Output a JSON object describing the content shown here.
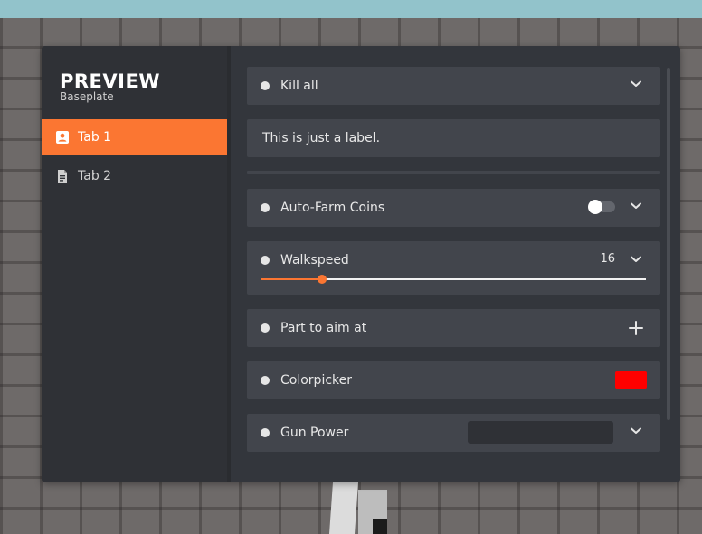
{
  "window": {
    "title": "PREVIEW",
    "subtitle": "Baseplate"
  },
  "tabs": [
    {
      "label": "Tab 1",
      "icon": "contact-card-icon",
      "active": true
    },
    {
      "label": "Tab 2",
      "icon": "document-icon",
      "active": false
    }
  ],
  "elements": {
    "kill_all": {
      "label": "Kill all"
    },
    "info_label": {
      "text": "This is just a label."
    },
    "auto_farm": {
      "label": "Auto-Farm Coins",
      "enabled": false
    },
    "walkspeed": {
      "label": "Walkspeed",
      "value": "16",
      "fraction": 0.16
    },
    "part_aim": {
      "label": "Part to aim at"
    },
    "colorpicker": {
      "label": "Colorpicker",
      "color": "#ff0000"
    },
    "gun_power": {
      "label": "Gun Power",
      "value": ""
    }
  },
  "colors": {
    "accent": "#fb7632",
    "window_bg": "#2f3136",
    "content_bg": "#33363c",
    "row_bg": "#42454c"
  }
}
